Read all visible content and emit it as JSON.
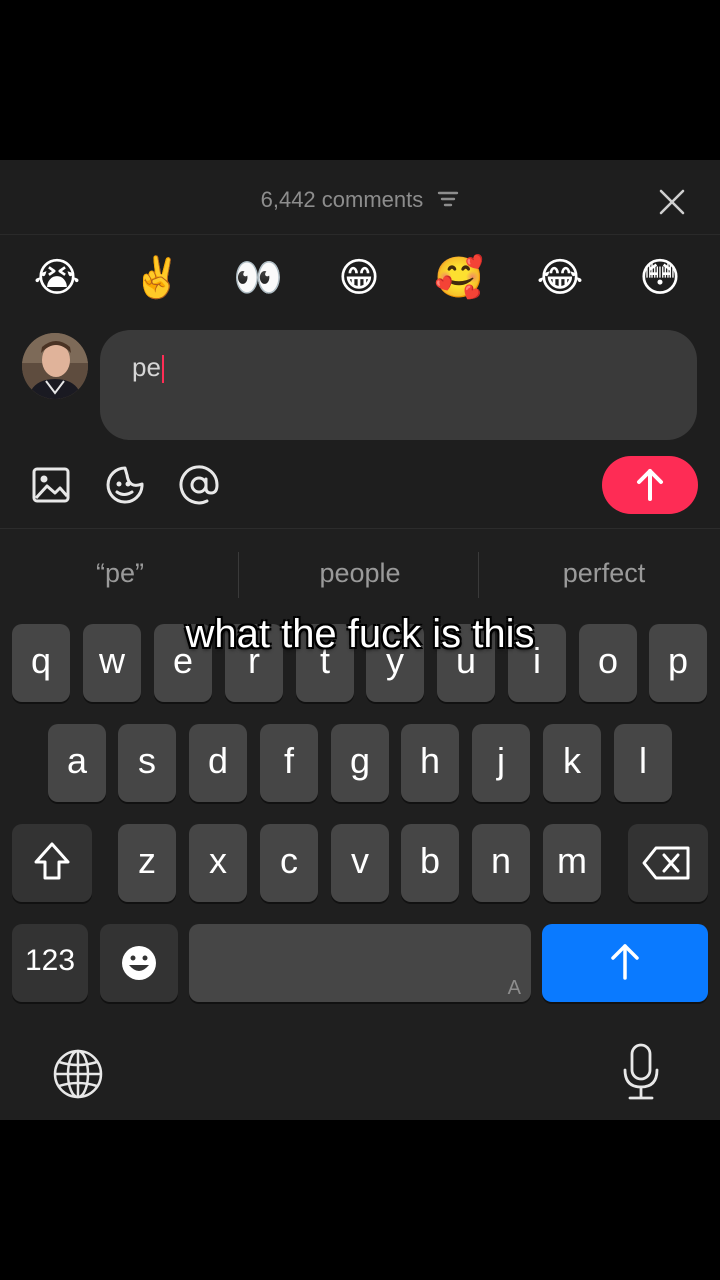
{
  "header": {
    "comments_label": "6,442 comments"
  },
  "emoji_bar": [
    "😭",
    "✌️",
    "👀",
    "😁",
    "🥰",
    "😂",
    "😳"
  ],
  "composer": {
    "input_value": "pe"
  },
  "suggestions": [
    "“pe”",
    "people",
    "perfect"
  ],
  "keyboard": {
    "row1": [
      "q",
      "w",
      "e",
      "r",
      "t",
      "y",
      "u",
      "i",
      "o",
      "p"
    ],
    "row2": [
      "a",
      "s",
      "d",
      "f",
      "g",
      "h",
      "j",
      "k",
      "l"
    ],
    "row3": [
      "z",
      "x",
      "c",
      "v",
      "b",
      "n",
      "m"
    ],
    "numbers_label": "123",
    "space_hint": "A"
  },
  "caption": "what the fuck is this",
  "colors": {
    "send": "#fe2c55",
    "return": "#0a7aff",
    "caret": "#ff2d55"
  }
}
